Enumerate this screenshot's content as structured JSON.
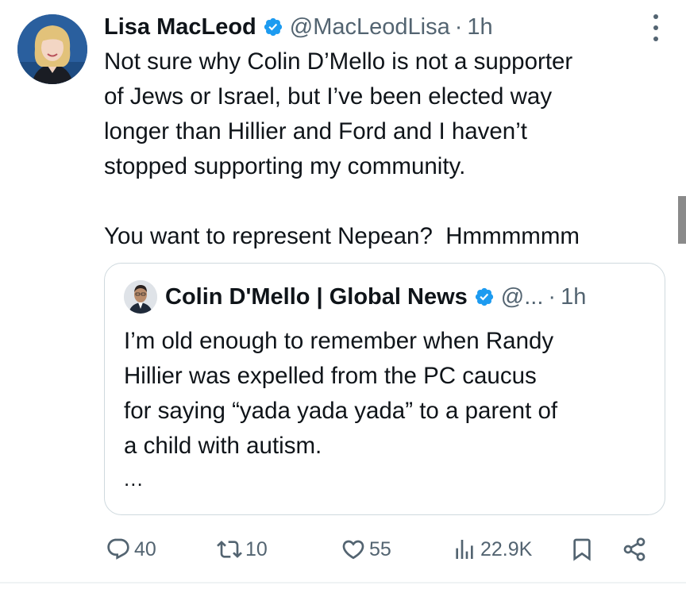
{
  "tweet": {
    "author_name": "Lisa MacLeod",
    "author_handle": "@MacLeodLisa",
    "separator": "·",
    "time": "1h",
    "text": "Not sure why Colin D’Mello is not a supporter\nof Jews or Israel, but I’ve been elected way\nlonger than Hillier and Ford and I haven’t\nstopped supporting my community.\n\nYou want to represent Nepean?  Hmmmmmm"
  },
  "quote": {
    "author_name": "Colin D'Mello | Global News",
    "author_handle": "@...",
    "separator": "·",
    "time": "1h",
    "text": "I’m old enough to remember when Randy\nHillier was expelled from the PC caucus\nfor saying “yada yada yada” to a parent of\na child with autism.",
    "more": "..."
  },
  "actions": {
    "reply_count": "40",
    "retweet_count": "10",
    "like_count": "55",
    "view_count": "22.9K"
  },
  "colors": {
    "verified": "#1d9bf0",
    "text_primary": "#0f1419",
    "text_secondary": "#536471",
    "border": "#cfd9de"
  },
  "icons": [
    "verified-badge-icon",
    "more-icon",
    "reply-icon",
    "retweet-icon",
    "like-icon",
    "views-icon",
    "bookmark-icon",
    "share-icon"
  ]
}
